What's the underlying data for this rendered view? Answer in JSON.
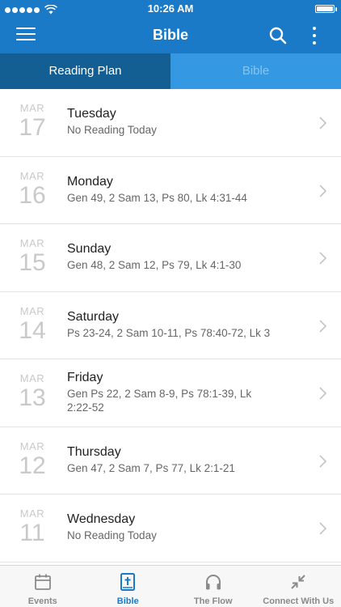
{
  "status_bar": {
    "time": "10:26 AM"
  },
  "header": {
    "title": "Bible"
  },
  "tabs": [
    {
      "label": "Reading Plan",
      "active": true
    },
    {
      "label": "Bible",
      "active": false
    }
  ],
  "readings": [
    {
      "month": "MAR",
      "day": "17",
      "weekday": "Tuesday",
      "passages": "No Reading Today"
    },
    {
      "month": "MAR",
      "day": "16",
      "weekday": "Monday",
      "passages": "Gen 49, 2 Sam 13, Ps 80, Lk 4:31-44"
    },
    {
      "month": "MAR",
      "day": "15",
      "weekday": "Sunday",
      "passages": "Gen 48, 2 Sam 12, Ps 79, Lk 4:1-30"
    },
    {
      "month": "MAR",
      "day": "14",
      "weekday": "Saturday",
      "passages": "Ps 23-24, 2 Sam 10-11, Ps 78:40-72, Lk 3"
    },
    {
      "month": "MAR",
      "day": "13",
      "weekday": "Friday",
      "passages": "Gen Ps 22, 2 Sam 8-9, Ps 78:1-39, Lk 2:22-52"
    },
    {
      "month": "MAR",
      "day": "12",
      "weekday": "Thursday",
      "passages": "Gen 47, 2 Sam 7, Ps 77, Lk 2:1-21"
    },
    {
      "month": "MAR",
      "day": "11",
      "weekday": "Wednesday",
      "passages": "No Reading Today"
    }
  ],
  "tab_bar": [
    {
      "label": "Events",
      "icon": "calendar-icon",
      "active": false
    },
    {
      "label": "Bible",
      "icon": "bible-icon",
      "active": true
    },
    {
      "label": "The Flow",
      "icon": "headphones-icon",
      "active": false
    },
    {
      "label": "Connect With Us",
      "icon": "connect-icon",
      "active": false
    }
  ],
  "colors": {
    "primary": "#1b7ac7",
    "tab_active": "#135e93",
    "tab_inactive": "#3499e2"
  }
}
